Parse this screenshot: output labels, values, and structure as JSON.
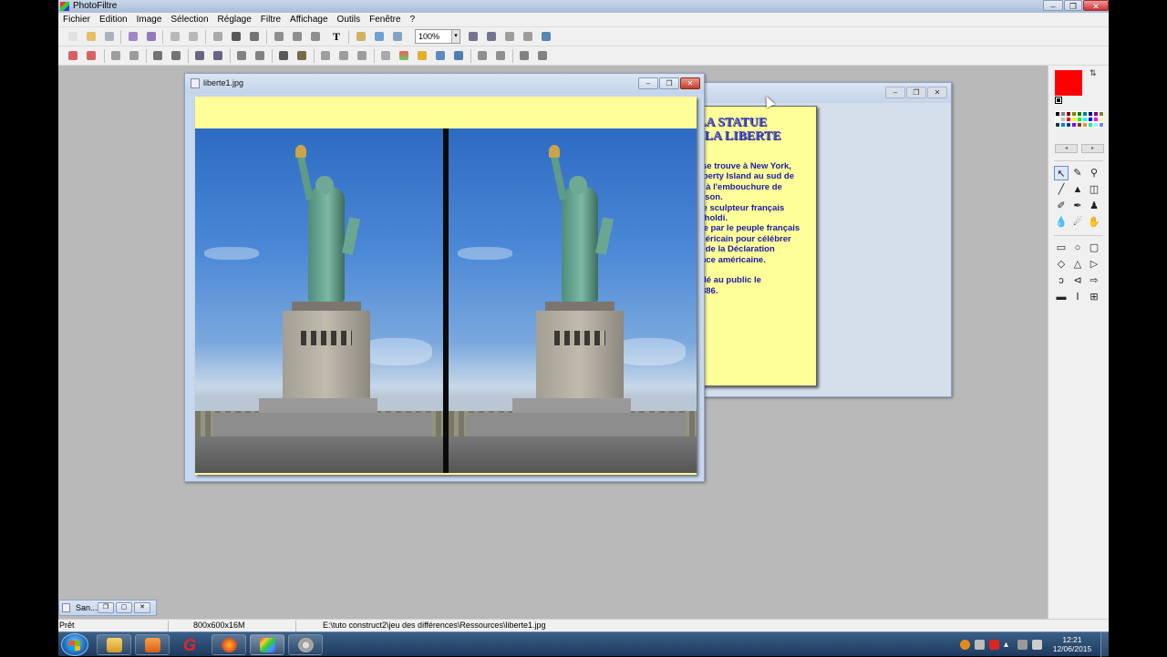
{
  "app": {
    "title": "PhotoFiltre",
    "window_buttons": [
      "–",
      "❐",
      "✕"
    ]
  },
  "menu": [
    "Fichier",
    "Edition",
    "Image",
    "Sélection",
    "Réglage",
    "Filtre",
    "Affichage",
    "Outils",
    "Fenêtre",
    "?"
  ],
  "toolbar": {
    "zoom_value": "100%",
    "text_tool_label": "T"
  },
  "windows": {
    "main": {
      "title": "liberte1.jpg"
    },
    "back": {
      "heading_line1": "LA STATUE",
      "heading_line2": "DE LA LIBERTE",
      "body": "Cette statue se trouve à New York,\nsur l'île de Liberty Island au sud de\nManhattan et à l'embouchure de\nla rivière Hudson.\nConçue par le sculpteur français\nAuguste Bartholdi.\nElle fut offerte par le peuple français\nau peuple américain pour célébrer\nle centenaire de la Déclaration\nd'indépendance américaine.\n\nElle fut dévoilé au public le\n28 octobre 1886."
    },
    "minimized": {
      "title": "San..."
    }
  },
  "palette": {
    "foreground_color": "#ff0000",
    "background_color": "#ffffff",
    "swatches": [
      "#000000",
      "#808080",
      "#800000",
      "#808000",
      "#008000",
      "#008080",
      "#000080",
      "#800080",
      "#808040",
      "#ffffff",
      "#c0c0c0",
      "#ff0000",
      "#ffff00",
      "#00ff00",
      "#00ffff",
      "#0000ff",
      "#ff00ff",
      "#ffff80",
      "#004040",
      "#0080ff",
      "#004080",
      "#8000ff",
      "#804000",
      "#ff8040",
      "#00ff80",
      "#80ffff",
      "#8080ff"
    ],
    "tools": [
      "↖",
      "✎",
      "⚲",
      "╱",
      "▲",
      "◫",
      "✐",
      "✒",
      "♟",
      "💧",
      "☄",
      "✋"
    ],
    "shapes": [
      "▭",
      "○",
      "▢",
      "◇",
      "△",
      "▷"
    ],
    "lassos": [
      "ↄ",
      "⊲",
      "⇨"
    ],
    "options": [
      "▬",
      "Ⅰ",
      "⊞"
    ]
  },
  "statusbar": {
    "state": "Prêt",
    "image_size": "800x600x16M",
    "path": "E:\\tuto construct2\\jeu des différences\\Ressources\\liberte1.jpg"
  },
  "taskbar": {
    "time": "12:21",
    "date": "12/06/2015"
  }
}
